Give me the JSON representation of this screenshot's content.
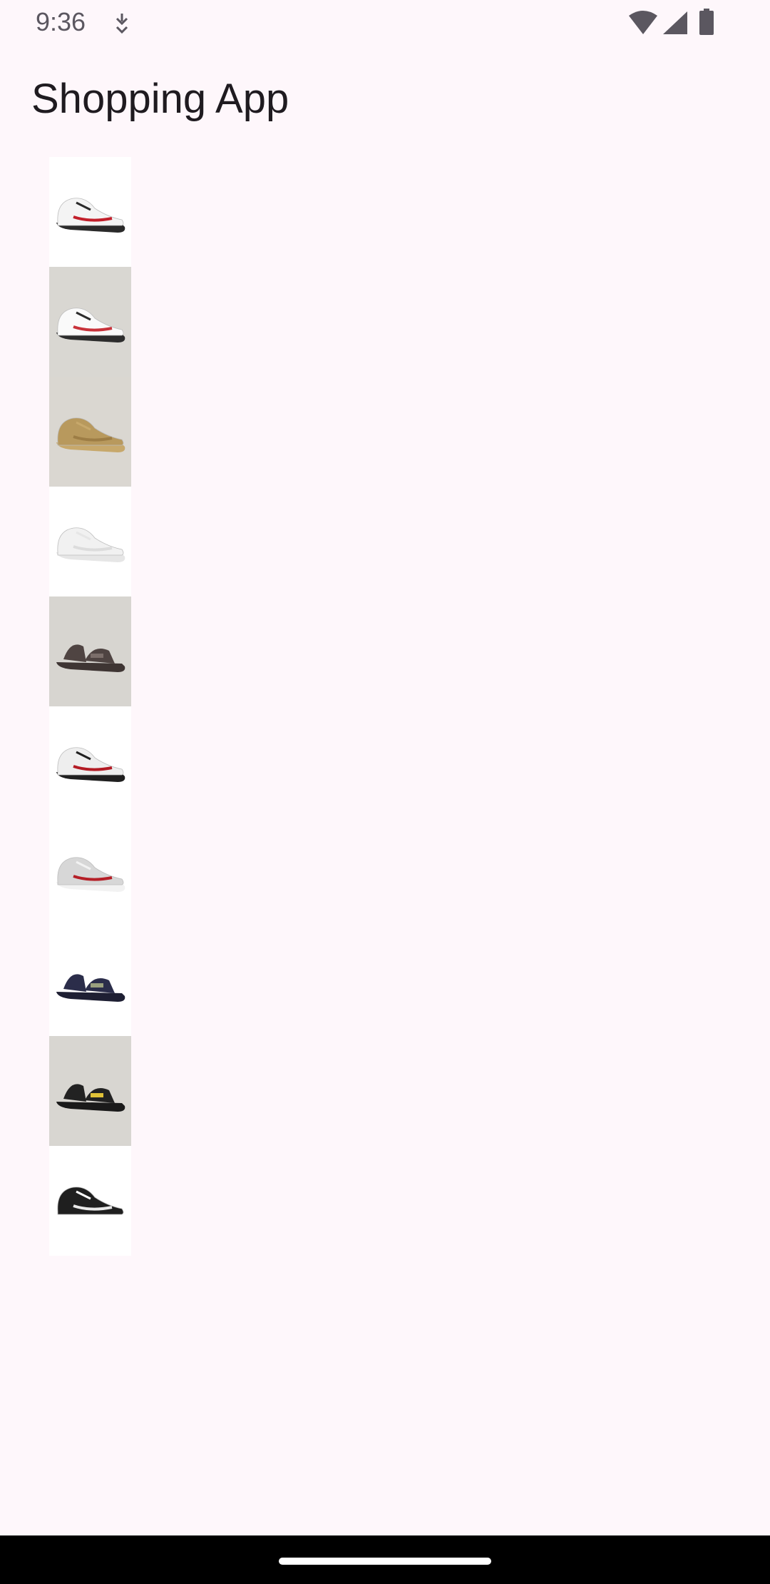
{
  "status_bar": {
    "time": "9:36",
    "icons": [
      "download-icon",
      "wifi-icon",
      "signal-icon",
      "battery-icon"
    ]
  },
  "app": {
    "title": "Shopping App"
  },
  "products": [
    {
      "type": "white black red sneaker",
      "bg": "#ffffff",
      "upper": "#f4f4f4",
      "accent": "#c21f2a",
      "sole": "#2a2a2a"
    },
    {
      "type": "white red striped running shoe",
      "bg": "#d9d7d2",
      "upper": "#fafafa",
      "accent": "#c8323a",
      "sole": "#2c2c2c"
    },
    {
      "type": "tan suede sneaker",
      "bg": "#dad7d1",
      "upper": "#b8995d",
      "accent": "#9d7d45",
      "sole": "#c7a86b"
    },
    {
      "type": "white sneaker",
      "bg": "#ffffff",
      "upper": "#f1f1f1",
      "accent": "#dcdcdc",
      "sole": "#e6e6e6"
    },
    {
      "type": "brown sandal",
      "bg": "#d7d5d0",
      "upper": "#4f4442",
      "accent": "#7b6e6a",
      "sole": "#3e3533"
    },
    {
      "type": "black red running shoe",
      "bg": "#ffffff",
      "upper": "#eeeeee",
      "accent": "#b31b24",
      "sole": "#1f1f1f"
    },
    {
      "type": "silver red running shoe",
      "bg": "#ffffff",
      "upper": "#d7d7d7",
      "accent": "#b51f27",
      "sole": "#f2f2f2"
    },
    {
      "type": "navy grey sandal",
      "bg": "#ffffff",
      "upper": "#2b2d4a",
      "accent": "#9aa07e",
      "sole": "#1e1f33"
    },
    {
      "type": "black yellow sandal",
      "bg": "#d8d6d1",
      "upper": "#222222",
      "accent": "#e0c238",
      "sole": "#1a1a1a"
    },
    {
      "type": "black white striped sneaker",
      "bg": "#ffffff",
      "upper": "#1f1f1f",
      "accent": "#e9e9e9",
      "sole": "#ffffff"
    }
  ],
  "colors": {
    "background": "#fef7fb",
    "title": "#1f1b20",
    "status_text": "#5b5760",
    "nav_bar": "#000000"
  }
}
